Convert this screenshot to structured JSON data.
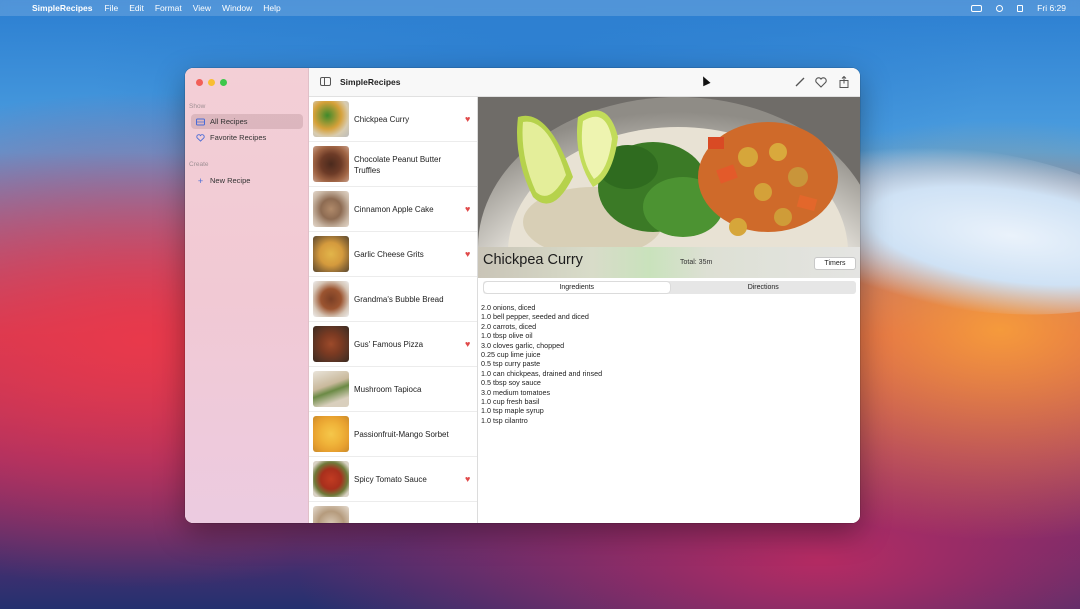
{
  "menubar": {
    "app_name": "SimpleRecipes",
    "items": [
      "File",
      "Edit",
      "Format",
      "View",
      "Window",
      "Help"
    ],
    "clock": "Fri 6:29"
  },
  "window": {
    "title": "SimpleRecipes",
    "sidebar": {
      "show_header": "Show",
      "create_header": "Create",
      "all_recipes": "All Recipes",
      "favorite_recipes": "Favorite Recipes",
      "new_recipe": "New Recipe"
    },
    "recipes": [
      {
        "name": "Chickpea Curry",
        "favorite": true
      },
      {
        "name": "Chocolate Peanut Butter Truffles",
        "favorite": false
      },
      {
        "name": "Cinnamon Apple Cake",
        "favorite": true
      },
      {
        "name": "Garlic Cheese Grits",
        "favorite": true
      },
      {
        "name": "Grandma's Bubble Bread",
        "favorite": false
      },
      {
        "name": "Gus' Famous Pizza",
        "favorite": true
      },
      {
        "name": "Mushroom Tapioca",
        "favorite": false
      },
      {
        "name": "Passionfruit-Mango Sorbet",
        "favorite": false
      },
      {
        "name": "Spicy Tomato Sauce",
        "favorite": true
      }
    ],
    "detail": {
      "title": "Chickpea Curry",
      "total": "Total: 35m",
      "timers_button": "Timers",
      "tabs": [
        "Ingredients",
        "Directions"
      ],
      "ingredients": [
        "2.0  onions, diced",
        "1.0  bell pepper, seeded and diced",
        "2.0  carrots, diced",
        "1.0 tbsp olive oil",
        "3.0  cloves garlic, chopped",
        "0.25 cup lime juice",
        "0.5 tsp curry paste",
        "1.0  can chickpeas, drained and rinsed",
        "0.5 tbsp soy sauce",
        "3.0  medium tomatoes",
        "1.0 cup fresh basil",
        "1.0 tsp maple syrup",
        "1.0 tsp cilantro"
      ]
    }
  },
  "colors": {
    "favorite_heart": "#e04a4a",
    "sidebar_accent": "#4a6bd6"
  }
}
